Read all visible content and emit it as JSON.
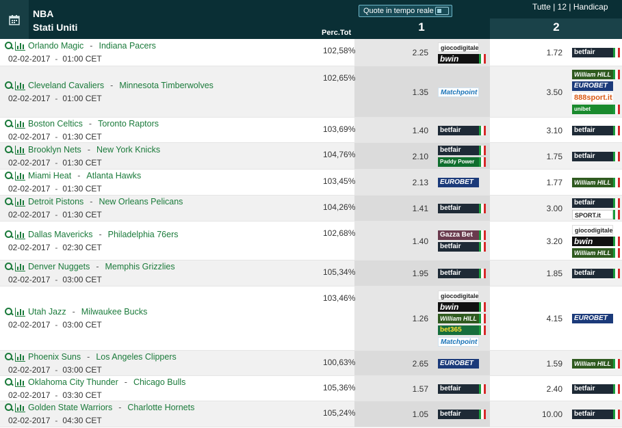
{
  "header": {
    "league": "NBA",
    "country": "Stati Uniti",
    "live_button": "Quote in tempo reale",
    "filters": "Tutte | 12 | Handicap",
    "perc_label": "Perc.Tot",
    "col1": "1",
    "col2": "2"
  },
  "rows": [
    {
      "home": "Orlando Magic",
      "away": "Indiana Pacers",
      "date": "02-02-2017",
      "time": "01:00 CET",
      "perc": "102,58%",
      "odd1": "2.25",
      "odd2": "1.72",
      "books1": [
        "giocodigitale",
        "bwin"
      ],
      "books2": [
        "betfair"
      ]
    },
    {
      "home": "Cleveland Cavaliers",
      "away": "Minnesota Timberwolves",
      "date": "02-02-2017",
      "time": "01:00 CET",
      "perc": "102,65%",
      "odd1": "1.35",
      "odd2": "3.50",
      "books1": [
        "Matchpoint"
      ],
      "books2": [
        "William HILL",
        "EUROBET",
        "888sport.it",
        "unibet"
      ]
    },
    {
      "home": "Boston Celtics",
      "away": "Toronto Raptors",
      "date": "02-02-2017",
      "time": "01:30 CET",
      "perc": "103,69%",
      "odd1": "1.40",
      "odd2": "3.10",
      "books1": [
        "betfair"
      ],
      "books2": [
        "betfair"
      ]
    },
    {
      "home": "Brooklyn Nets",
      "away": "New York Knicks",
      "date": "02-02-2017",
      "time": "01:30 CET",
      "perc": "104,76%",
      "odd1": "2.10",
      "odd2": "1.75",
      "books1": [
        "betfair",
        "Paddy Power"
      ],
      "books2": [
        "betfair"
      ]
    },
    {
      "home": "Miami Heat",
      "away": "Atlanta Hawks",
      "date": "02-02-2017",
      "time": "01:30 CET",
      "perc": "103,45%",
      "odd1": "2.13",
      "odd2": "1.77",
      "books1": [
        "EUROBET"
      ],
      "books2": [
        "William HILL"
      ]
    },
    {
      "home": "Detroit Pistons",
      "away": "New Orleans Pelicans",
      "date": "02-02-2017",
      "time": "01:30 CET",
      "perc": "104,26%",
      "odd1": "1.41",
      "odd2": "3.00",
      "books1": [
        "betfair"
      ],
      "books2": [
        "betfair",
        "SPORT.it"
      ]
    },
    {
      "home": "Dallas Mavericks",
      "away": "Philadelphia 76ers",
      "date": "02-02-2017",
      "time": "02:30 CET",
      "perc": "102,68%",
      "odd1": "1.40",
      "odd2": "3.20",
      "books1": [
        "Gazza Bet",
        "betfair"
      ],
      "books2": [
        "giocodigitale",
        "bwin",
        "William HILL"
      ]
    },
    {
      "home": "Denver Nuggets",
      "away": "Memphis Grizzlies",
      "date": "02-02-2017",
      "time": "03:00 CET",
      "perc": "105,34%",
      "odd1": "1.95",
      "odd2": "1.85",
      "books1": [
        "betfair"
      ],
      "books2": [
        "betfair"
      ]
    },
    {
      "home": "Utah Jazz",
      "away": "Milwaukee Bucks",
      "date": "02-02-2017",
      "time": "03:00 CET",
      "perc": "103,46%",
      "odd1": "1.26",
      "odd2": "4.15",
      "books1": [
        "giocodigitale",
        "bwin",
        "William HILL",
        "bet365",
        "Matchpoint"
      ],
      "books2": [
        "EUROBET"
      ]
    },
    {
      "home": "Phoenix Suns",
      "away": "Los Angeles Clippers",
      "date": "02-02-2017",
      "time": "03:00 CET",
      "perc": "100,63%",
      "odd1": "2.65",
      "odd2": "1.59",
      "books1": [
        "EUROBET"
      ],
      "books2": [
        "William HILL"
      ]
    },
    {
      "home": "Oklahoma City Thunder",
      "away": "Chicago Bulls",
      "date": "02-02-2017",
      "time": "03:30 CET",
      "perc": "105,36%",
      "odd1": "1.57",
      "odd2": "2.40",
      "books1": [
        "betfair"
      ],
      "books2": [
        "betfair"
      ]
    },
    {
      "home": "Golden State Warriors",
      "away": "Charlotte Hornets",
      "date": "02-02-2017",
      "time": "04:30 CET",
      "perc": "105,24%",
      "odd1": "1.05",
      "odd2": "10.00",
      "books1": [
        "betfair"
      ],
      "books2": [
        "betfair"
      ]
    }
  ]
}
